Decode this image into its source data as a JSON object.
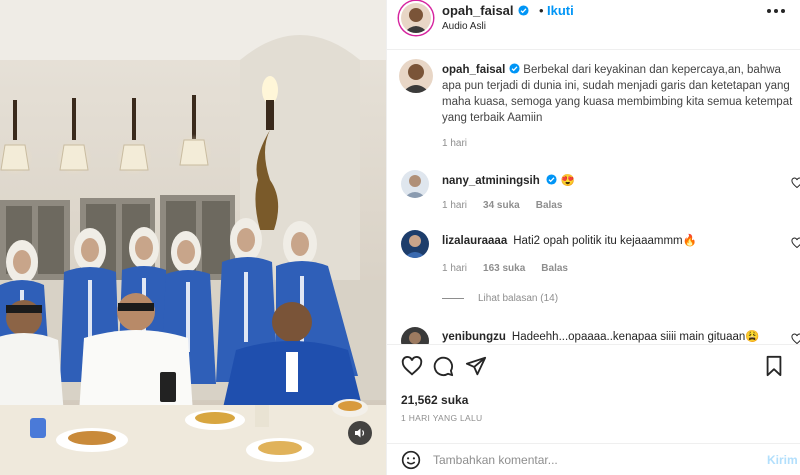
{
  "post": {
    "username": "opah_faisal",
    "separator": "•",
    "follow_label": "Ikuti",
    "audio_label": "Audio Asli"
  },
  "caption": {
    "username": "opah_faisal",
    "text": "Berbekal dari keyakinan dan kepercaya,an, bahwa apa pun terjadi di dunia ini, sudah menjadi garis dan ketetapan yang maha kuasa, semoga yang kuasa membimbing kita semua ketempat yang terbaik Aamiin",
    "time": "1 hari"
  },
  "comments": [
    {
      "username": "nany_atminingsih",
      "text": "😍",
      "time": "1 hari",
      "likes": "34 suka",
      "reply_label": "Balas"
    },
    {
      "username": "lizalauraaaa",
      "text": "Hati2 opah politik itu kejaaammm🔥",
      "time": "1 hari",
      "likes": "163 suka",
      "reply_label": "Balas",
      "view_replies": "Lihat balasan (14)"
    },
    {
      "username": "yenibungzu",
      "text": "Hadeehh...opaaaa..kenapaa siiii main gituaan😩"
    }
  ],
  "stats": {
    "likes": "21,562 suka",
    "posted": "1 HARI YANG LALU"
  },
  "composer": {
    "placeholder": "Tambahkan komentar...",
    "send_label": "Kirim"
  },
  "colors": {
    "accent": "#0095f6",
    "verified": "#0095f6",
    "secondary_text": "#8e8e8e",
    "divider": "#efefef"
  },
  "icons": [
    "verified-icon",
    "more-options-icon",
    "heart-icon",
    "comment-icon",
    "share-icon",
    "bookmark-icon",
    "emoji-icon",
    "volume-icon"
  ]
}
